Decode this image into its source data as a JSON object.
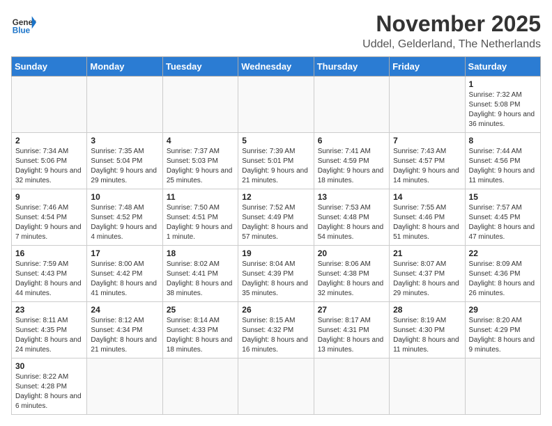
{
  "header": {
    "logo_general": "General",
    "logo_blue": "Blue",
    "month_title": "November 2025",
    "location": "Uddel, Gelderland, The Netherlands"
  },
  "weekdays": [
    "Sunday",
    "Monday",
    "Tuesday",
    "Wednesday",
    "Thursday",
    "Friday",
    "Saturday"
  ],
  "weeks": [
    [
      {
        "day": "",
        "info": ""
      },
      {
        "day": "",
        "info": ""
      },
      {
        "day": "",
        "info": ""
      },
      {
        "day": "",
        "info": ""
      },
      {
        "day": "",
        "info": ""
      },
      {
        "day": "",
        "info": ""
      },
      {
        "day": "1",
        "info": "Sunrise: 7:32 AM\nSunset: 5:08 PM\nDaylight: 9 hours\nand 36 minutes."
      }
    ],
    [
      {
        "day": "2",
        "info": "Sunrise: 7:34 AM\nSunset: 5:06 PM\nDaylight: 9 hours\nand 32 minutes."
      },
      {
        "day": "3",
        "info": "Sunrise: 7:35 AM\nSunset: 5:04 PM\nDaylight: 9 hours\nand 29 minutes."
      },
      {
        "day": "4",
        "info": "Sunrise: 7:37 AM\nSunset: 5:03 PM\nDaylight: 9 hours\nand 25 minutes."
      },
      {
        "day": "5",
        "info": "Sunrise: 7:39 AM\nSunset: 5:01 PM\nDaylight: 9 hours\nand 21 minutes."
      },
      {
        "day": "6",
        "info": "Sunrise: 7:41 AM\nSunset: 4:59 PM\nDaylight: 9 hours\nand 18 minutes."
      },
      {
        "day": "7",
        "info": "Sunrise: 7:43 AM\nSunset: 4:57 PM\nDaylight: 9 hours\nand 14 minutes."
      },
      {
        "day": "8",
        "info": "Sunrise: 7:44 AM\nSunset: 4:56 PM\nDaylight: 9 hours\nand 11 minutes."
      }
    ],
    [
      {
        "day": "9",
        "info": "Sunrise: 7:46 AM\nSunset: 4:54 PM\nDaylight: 9 hours\nand 7 minutes."
      },
      {
        "day": "10",
        "info": "Sunrise: 7:48 AM\nSunset: 4:52 PM\nDaylight: 9 hours\nand 4 minutes."
      },
      {
        "day": "11",
        "info": "Sunrise: 7:50 AM\nSunset: 4:51 PM\nDaylight: 9 hours\nand 1 minute."
      },
      {
        "day": "12",
        "info": "Sunrise: 7:52 AM\nSunset: 4:49 PM\nDaylight: 8 hours\nand 57 minutes."
      },
      {
        "day": "13",
        "info": "Sunrise: 7:53 AM\nSunset: 4:48 PM\nDaylight: 8 hours\nand 54 minutes."
      },
      {
        "day": "14",
        "info": "Sunrise: 7:55 AM\nSunset: 4:46 PM\nDaylight: 8 hours\nand 51 minutes."
      },
      {
        "day": "15",
        "info": "Sunrise: 7:57 AM\nSunset: 4:45 PM\nDaylight: 8 hours\nand 47 minutes."
      }
    ],
    [
      {
        "day": "16",
        "info": "Sunrise: 7:59 AM\nSunset: 4:43 PM\nDaylight: 8 hours\nand 44 minutes."
      },
      {
        "day": "17",
        "info": "Sunrise: 8:00 AM\nSunset: 4:42 PM\nDaylight: 8 hours\nand 41 minutes."
      },
      {
        "day": "18",
        "info": "Sunrise: 8:02 AM\nSunset: 4:41 PM\nDaylight: 8 hours\nand 38 minutes."
      },
      {
        "day": "19",
        "info": "Sunrise: 8:04 AM\nSunset: 4:39 PM\nDaylight: 8 hours\nand 35 minutes."
      },
      {
        "day": "20",
        "info": "Sunrise: 8:06 AM\nSunset: 4:38 PM\nDaylight: 8 hours\nand 32 minutes."
      },
      {
        "day": "21",
        "info": "Sunrise: 8:07 AM\nSunset: 4:37 PM\nDaylight: 8 hours\nand 29 minutes."
      },
      {
        "day": "22",
        "info": "Sunrise: 8:09 AM\nSunset: 4:36 PM\nDaylight: 8 hours\nand 26 minutes."
      }
    ],
    [
      {
        "day": "23",
        "info": "Sunrise: 8:11 AM\nSunset: 4:35 PM\nDaylight: 8 hours\nand 24 minutes."
      },
      {
        "day": "24",
        "info": "Sunrise: 8:12 AM\nSunset: 4:34 PM\nDaylight: 8 hours\nand 21 minutes."
      },
      {
        "day": "25",
        "info": "Sunrise: 8:14 AM\nSunset: 4:33 PM\nDaylight: 8 hours\nand 18 minutes."
      },
      {
        "day": "26",
        "info": "Sunrise: 8:15 AM\nSunset: 4:32 PM\nDaylight: 8 hours\nand 16 minutes."
      },
      {
        "day": "27",
        "info": "Sunrise: 8:17 AM\nSunset: 4:31 PM\nDaylight: 8 hours\nand 13 minutes."
      },
      {
        "day": "28",
        "info": "Sunrise: 8:19 AM\nSunset: 4:30 PM\nDaylight: 8 hours\nand 11 minutes."
      },
      {
        "day": "29",
        "info": "Sunrise: 8:20 AM\nSunset: 4:29 PM\nDaylight: 8 hours\nand 9 minutes."
      }
    ],
    [
      {
        "day": "30",
        "info": "Sunrise: 8:22 AM\nSunset: 4:28 PM\nDaylight: 8 hours\nand 6 minutes."
      },
      {
        "day": "",
        "info": ""
      },
      {
        "day": "",
        "info": ""
      },
      {
        "day": "",
        "info": ""
      },
      {
        "day": "",
        "info": ""
      },
      {
        "day": "",
        "info": ""
      },
      {
        "day": "",
        "info": ""
      }
    ]
  ]
}
